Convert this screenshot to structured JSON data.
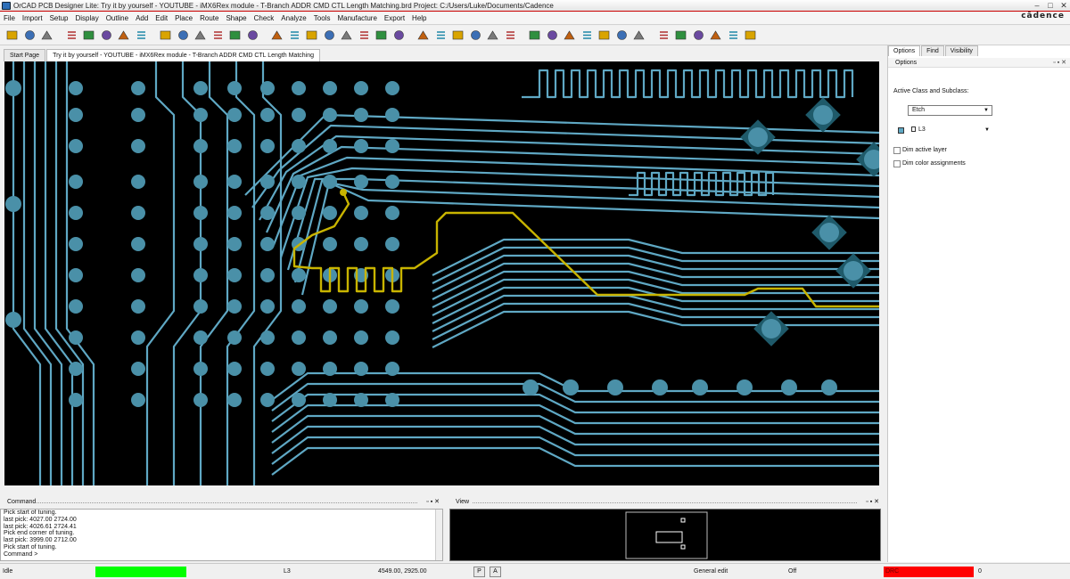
{
  "window": {
    "title": "OrCAD PCB Designer Lite: Try it by yourself - YOUTUBE - iMX6Rex module - T-Branch ADDR CMD CTL Length Matching.brd  Project: C:/Users/Luke/Documents/Cadence",
    "brand": "cādence"
  },
  "menu": [
    "File",
    "Import",
    "Setup",
    "Display",
    "Outline",
    "Add",
    "Edit",
    "Place",
    "Route",
    "Shape",
    "Check",
    "Analyze",
    "Tools",
    "Manufacture",
    "Export",
    "Help"
  ],
  "tabs": [
    {
      "label": "Start Page",
      "active": false
    },
    {
      "label": "Try it by yourself - YOUTUBE - iMX6Rex module - T-Branch ADDR CMD CTL Length Matching",
      "active": true
    }
  ],
  "panel": {
    "tabs": [
      "Options",
      "Find",
      "Visibility"
    ],
    "header": "Options",
    "active_class_label": "Active Class and Subclass:",
    "class_value": "Etch",
    "subclass_value": "L3",
    "subclass_color": "#5fa8c4",
    "checkboxes": [
      {
        "label": "Dim active layer",
        "checked": false
      },
      {
        "label": "Dim color assignments",
        "checked": false
      }
    ]
  },
  "command": {
    "title": "Command",
    "lines": [
      "Pick start of tuning.",
      "last pick:  4027.00 2724.00",
      "last pick:  4026.61 2724.41",
      "Pick end corner of tuning.",
      "last pick:  3999.00 2712.00",
      "Pick start of tuning.",
      "Command >"
    ]
  },
  "view": {
    "title": "View"
  },
  "status": {
    "state": "Idle",
    "state_color": "#00ff00",
    "layer": "L3",
    "coords": "4549.00, 2925.00",
    "btn_p": "P",
    "btn_a": "A",
    "mode": "General edit",
    "mode2": "Off",
    "drc_label": "DRC",
    "drc_color": "#ff0000",
    "drc_count": "0"
  },
  "colors": {
    "trace": "#5fa8c4",
    "tuned_trace": "#c8b400",
    "canvas": "#000000",
    "pad": "#4a90a8"
  },
  "toolbar_icons": [
    "new-file-icon",
    "open-folder-icon",
    "save-icon",
    "cut-icon",
    "copy-icon",
    "delete-icon",
    "undo-icon",
    "redo-icon",
    "connect-icon",
    "pin-icon",
    "add-connect-icon",
    "slide-icon",
    "delay-tune-icon",
    "custom-smooth-icon",
    "grid-icon",
    "unrats-icon",
    "zoom-in-icon",
    "zoom-out-icon",
    "zoom-fit-icon",
    "zoom-previous-icon",
    "zoom-world-icon",
    "redraw-icon",
    "shape-icon",
    "3d-view-icon",
    "color-icon",
    "layer-icon",
    "measure-icon",
    "stats-icon",
    "drc-icon",
    "show-element-icon",
    "property-icon",
    "snap-icon",
    "highlight-icon",
    "dehighlight-icon",
    "assign-color-icon",
    "view-top-icon",
    "view-bottom-icon",
    "board-icon",
    "padstack-icon",
    "camera-icon",
    "window-icon"
  ]
}
